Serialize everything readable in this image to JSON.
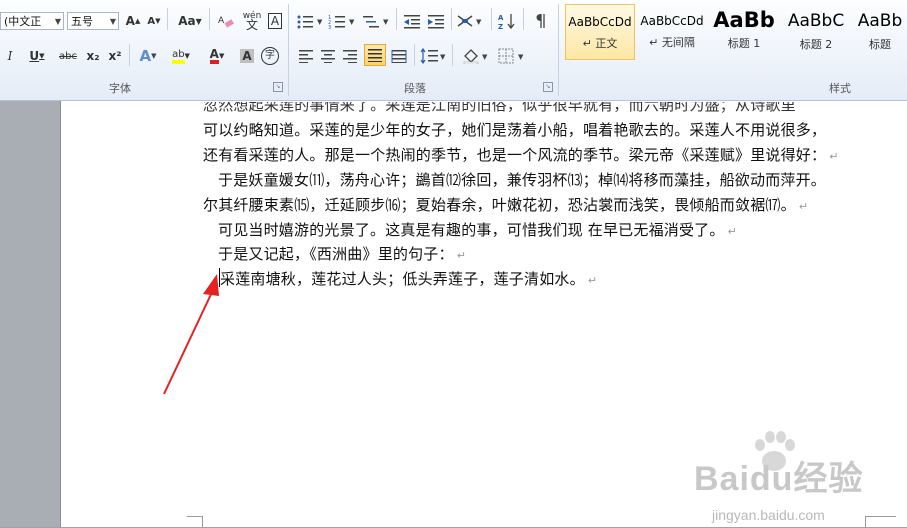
{
  "ribbon": {
    "font_group": {
      "label": "字体",
      "font_name": "(中文正",
      "font_size": "五号",
      "grow_font": "A",
      "shrink_font": "A",
      "change_case": "Aa",
      "pinyin": "wén",
      "border_char": "A",
      "italic": "I",
      "underline": "U",
      "strikethrough": "abc",
      "subscript": "x₂",
      "superscript": "x²",
      "text_effect": "A",
      "highlight": "ab",
      "font_color": "A",
      "char_shading": "A",
      "enclose_char": "字"
    },
    "paragraph_group": {
      "label": "段落"
    },
    "styles_group": {
      "label": "样式",
      "styles": [
        {
          "sample": "AaBbCcDd",
          "name": "↵ 正文"
        },
        {
          "sample": "AaBbCcDd",
          "name": "↵ 无间隔"
        },
        {
          "sample": "AaBb",
          "name": "标题 1"
        },
        {
          "sample": "AaBbC",
          "name": "标题 2"
        },
        {
          "sample": "AaBb",
          "name": "标题"
        }
      ]
    }
  },
  "document": {
    "lines": [
      "可以约略知道。采莲的是少年的女子，她们是荡着小船，唱着艳歌去的。采莲人不用说很多，",
      "还有看采莲的人。那是一个热闹的季节，也是一个风流的季节。梁元帝《采莲赋》里说得好：",
      "于是妖童媛女⑾，荡舟心许；鷁首⑿徐回，兼传羽杯⒀；棹⒁将移而藻挂，船欲动而萍开。",
      "尔其纤腰束素⒂，迁延顾步⒃；夏始春余，叶嫩花初，恐沾裳而浅笑，畏倾船而敛裾⒄。",
      "可见当时嬉游的光景了。这真是有趣的事，可惜我们现 在早已无福消受了。",
      "于是又记起，《西洲曲》里的句子：",
      "采莲南塘秋，莲花过人头；低头弄莲子，莲子清如水。"
    ],
    "paragraph_mark": "↵"
  },
  "watermark": {
    "brand": "Baidu经验",
    "url": "jingyan.baidu.com"
  }
}
